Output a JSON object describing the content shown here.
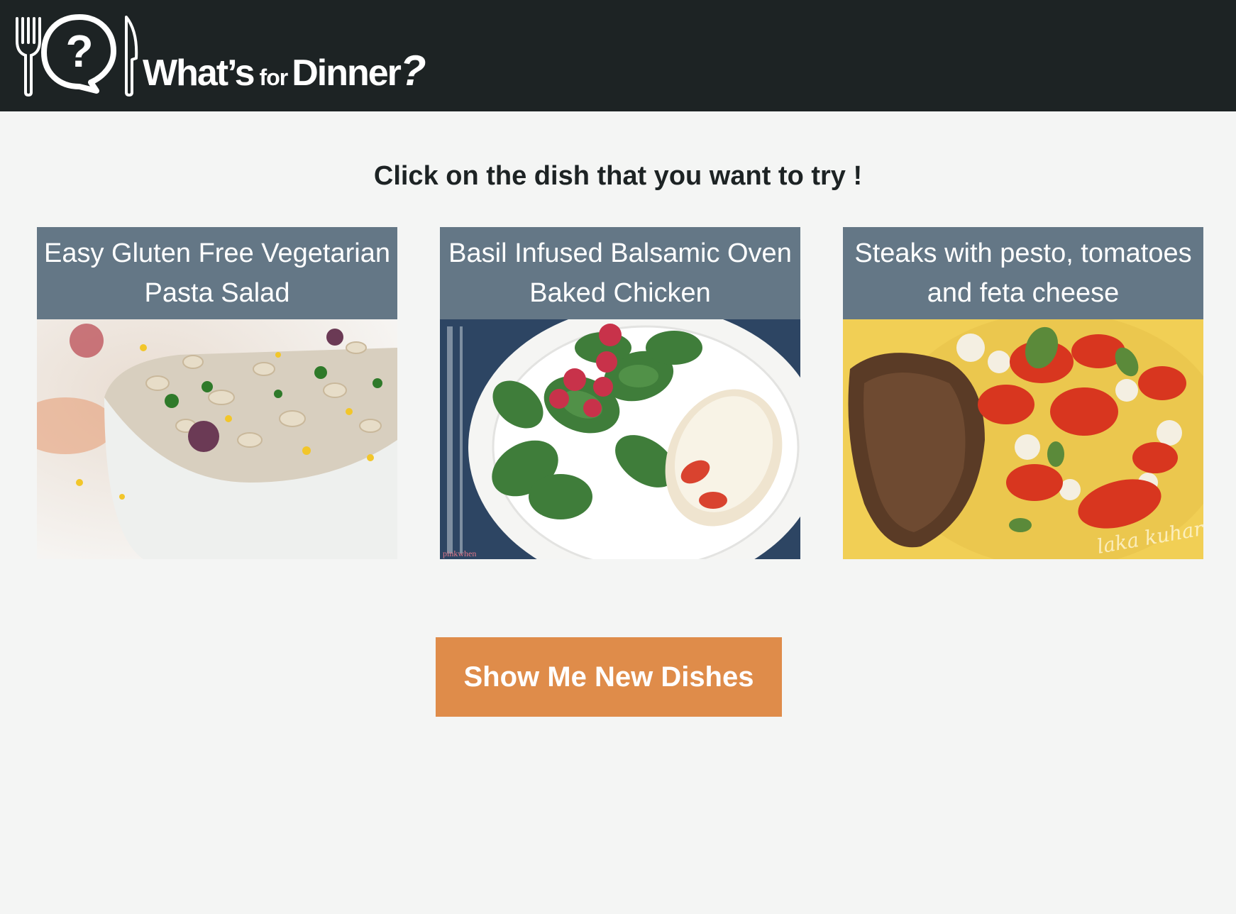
{
  "header": {
    "logo_text_main": "What’s",
    "logo_text_small": "for",
    "logo_text_end": "Dinner",
    "logo_text_q": "?",
    "icons": [
      "fork-icon",
      "question-bubble-icon",
      "knife-icon"
    ]
  },
  "main": {
    "instruction": "Click on the dish that you want to try !",
    "dishes": [
      {
        "title": "Easy Gluten Free Vegetarian Pasta Salad",
        "image": "pasta-salad-photo"
      },
      {
        "title": "Basil Infused Balsamic Oven Baked Chicken",
        "image": "chicken-spinach-photo"
      },
      {
        "title": "Steaks with pesto, tomatoes and feta cheese",
        "image": "steak-tomatoes-photo",
        "image_watermark": "laka kuharica"
      }
    ],
    "chicken_photo_watermark": "pinkwhen",
    "new_dishes_button": "Show Me New Dishes"
  },
  "colors": {
    "topbar": "#1d2324",
    "background": "#f4f5f4",
    "card_title_bg": "#647786",
    "button_bg": "#df8c4a",
    "text_dark": "#1d2324"
  }
}
